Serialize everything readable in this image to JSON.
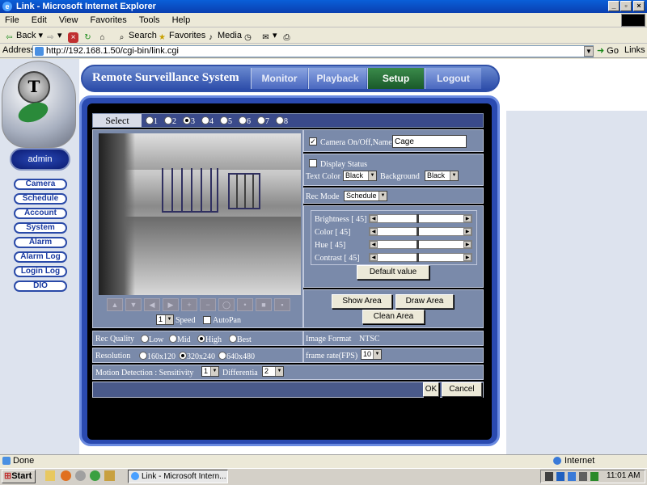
{
  "window": {
    "title": "Link - Microsoft Internet Explorer"
  },
  "menu": [
    "File",
    "Edit",
    "View",
    "Favorites",
    "Tools",
    "Help"
  ],
  "toolbar": {
    "back": "Back",
    "search": "Search",
    "favorites": "Favorites",
    "media": "Media"
  },
  "address": {
    "label": "Address",
    "url": "http://192.168.1.50/cgi-bin/link.cgi",
    "go": "Go",
    "links": "Links"
  },
  "app": {
    "title": "Remote Surveillance System",
    "tabs": [
      "Monitor",
      "Playback",
      "Setup",
      "Logout"
    ],
    "active_tab": "Setup",
    "user": "admin",
    "side_menu": [
      "Camera",
      "Schedule",
      "Account",
      "System",
      "Alarm",
      "Alarm Log",
      "Login Log",
      "DIO"
    ]
  },
  "camera": {
    "select_label": "Select",
    "channels": [
      "1",
      "2",
      "3",
      "4",
      "5",
      "6",
      "7",
      "8"
    ],
    "selected_channel": "3",
    "on_off_label": "Camera On/Off,Name",
    "name": "Cage",
    "display_status_label": "Display Status",
    "text_color_label": "Text Color",
    "text_color": "Black",
    "background_label": "Background",
    "background": "Black",
    "rec_mode_label": "Rec Mode",
    "rec_mode": "Schedule",
    "adjust": [
      {
        "label": "Brightness [ 45]",
        "value": 45
      },
      {
        "label": "Color [ 45]",
        "value": 45
      },
      {
        "label": "Hue [ 45]",
        "value": 45
      },
      {
        "label": "Contrast [ 45]",
        "value": 45
      }
    ],
    "default_value": "Default value",
    "show_area": "Show Area",
    "draw_area": "Draw Area",
    "clean_area": "Clean Area",
    "speed": "1",
    "speed_label": "Speed",
    "autopan_label": "AutoPan",
    "rec_quality_label": "Rec Quality",
    "qualities": [
      "Low",
      "Mid",
      "High",
      "Best"
    ],
    "selected_quality": "High",
    "image_format_label": "Image Format",
    "image_format": "NTSC",
    "resolution_label": "Resolution",
    "resolutions": [
      "160x120",
      "320x240",
      "640x480"
    ],
    "selected_resolution": "320x240",
    "frame_rate_label": "frame rate(FPS)",
    "frame_rate": "10",
    "motion_label": "Motion Detection : Sensitivity",
    "sensitivity": "1",
    "differential_label": "Differentia",
    "differential": "2",
    "ok": "OK",
    "cancel": "Cancel"
  },
  "status": {
    "left": "Done",
    "zone": "Internet"
  },
  "taskbar": {
    "start": "Start",
    "task": "Link - Microsoft Intern...",
    "time": "11:01 AM"
  }
}
